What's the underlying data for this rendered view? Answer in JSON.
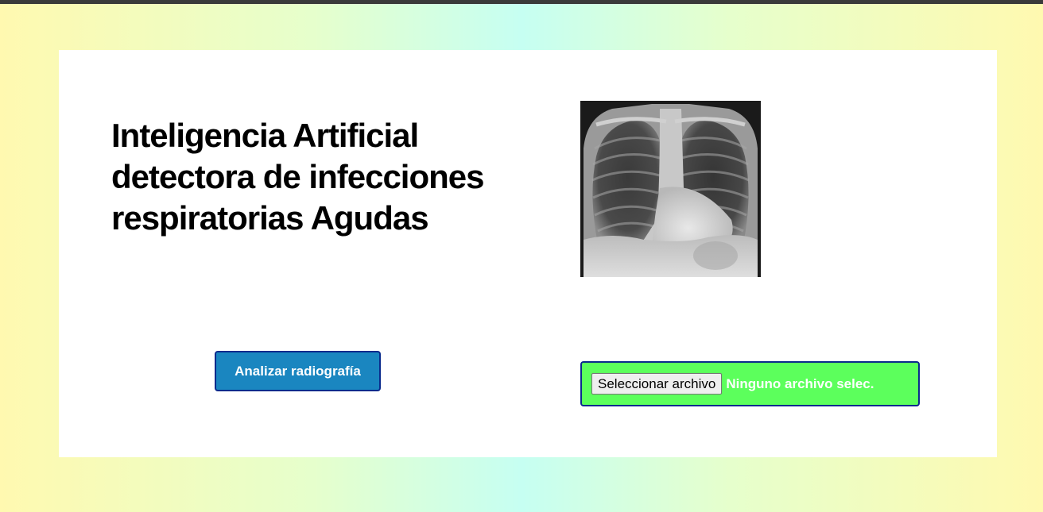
{
  "page": {
    "title_lines": [
      "Inteligencia Artificial",
      "detectora de infecciones",
      "respiratorias Agudas"
    ],
    "image": {
      "icon": "chest-xray-image"
    },
    "analyze_button": {
      "label": "Analizar radiografía"
    },
    "file_input": {
      "button_label": "Seleccionar archivo",
      "status": "Ninguno archivo selec."
    }
  },
  "colors": {
    "analyze_button_bg": "#1a86c0",
    "file_box_bg": "#5cff5c",
    "border": "#0a2a8c",
    "gradient_yellow": "#fff9b0",
    "gradient_cyan": "#c6fff2"
  }
}
